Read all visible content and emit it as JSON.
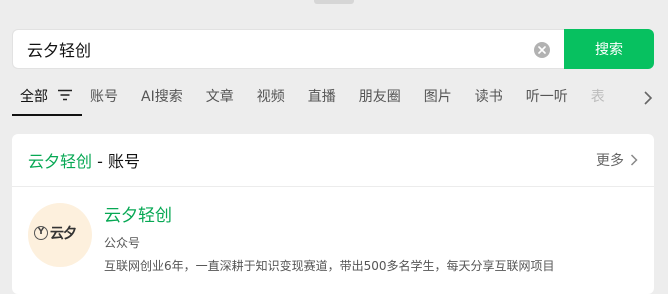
{
  "search": {
    "value": "云夕轻创",
    "button_label": "搜索"
  },
  "tabs": [
    {
      "label": "全部",
      "active": true
    },
    {
      "label": "账号"
    },
    {
      "label": "AI搜索"
    },
    {
      "label": "文章"
    },
    {
      "label": "视频"
    },
    {
      "label": "直播"
    },
    {
      "label": "朋友圈"
    },
    {
      "label": "图片"
    },
    {
      "label": "读书"
    },
    {
      "label": "听一听"
    },
    {
      "label": "表"
    }
  ],
  "section": {
    "title_keyword": "云夕轻创",
    "title_suffix": " - 账号",
    "more_label": "更多"
  },
  "result": {
    "avatar_text": "云夕",
    "avatar_mark": "Y",
    "name": "云夕轻创",
    "type": "公众号",
    "description": "互联网创业6年，一直深耕于知识变现赛道，带出500多名学生，每天分享互联网项目"
  },
  "colors": {
    "accent": "#07c160",
    "keyword": "#07a854",
    "background": "#ededed"
  }
}
